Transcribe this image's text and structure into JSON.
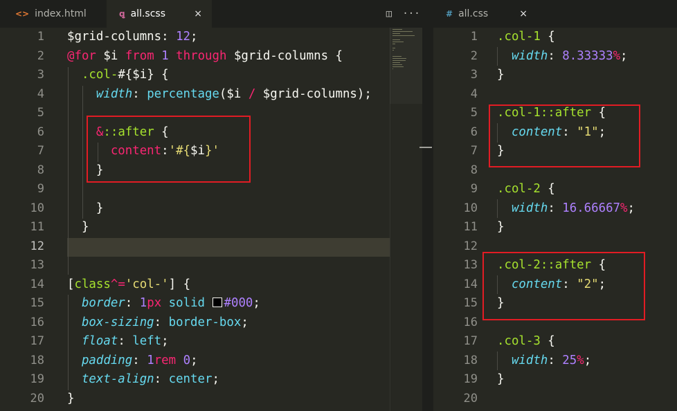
{
  "left_tabs": [
    {
      "label": "index.html",
      "icon": "code-icon",
      "glyph": "<>",
      "active": false
    },
    {
      "label": "all.scss",
      "icon": "scss-icon",
      "glyph": "ꝗ",
      "active": true,
      "close": "×"
    }
  ],
  "left_actions": [
    {
      "name": "split-editor-icon",
      "glyph": "◫"
    },
    {
      "name": "more-actions-icon",
      "glyph": "···"
    }
  ],
  "right_tabs": [
    {
      "label": "all.css",
      "icon": "hash-icon",
      "glyph": "#",
      "active": false,
      "close": "×"
    }
  ],
  "left_editor": {
    "line_numbers": [
      "1",
      "2",
      "3",
      "4",
      "5",
      "6",
      "7",
      "8",
      "9",
      "10",
      "11",
      "12",
      "13",
      "14",
      "15",
      "16",
      "17",
      "18",
      "19",
      "20"
    ],
    "current_line": "12",
    "lines": [
      [
        [
          "v",
          "$grid-columns"
        ],
        [
          "o",
          ": "
        ],
        [
          "n",
          "12"
        ],
        [
          "o",
          ";"
        ]
      ],
      [
        [
          "k",
          "@for"
        ],
        [
          "o",
          " "
        ],
        [
          "v",
          "$i"
        ],
        [
          "o",
          " "
        ],
        [
          "k",
          "from"
        ],
        [
          "o",
          " "
        ],
        [
          "n",
          "1"
        ],
        [
          "o",
          " "
        ],
        [
          "k",
          "through"
        ],
        [
          "o",
          " "
        ],
        [
          "v",
          "$grid-columns"
        ],
        [
          "o",
          " {"
        ]
      ],
      [
        [
          "o",
          "  "
        ],
        [
          "sel",
          ".col-"
        ],
        [
          "o",
          "#{"
        ],
        [
          "v",
          "$i"
        ],
        [
          "o",
          "} {"
        ]
      ],
      [
        [
          "o",
          "    "
        ],
        [
          "p",
          "width"
        ],
        [
          "o",
          ": "
        ],
        [
          "f",
          "percentage"
        ],
        [
          "o",
          "("
        ],
        [
          "v",
          "$i"
        ],
        [
          "o",
          " "
        ],
        [
          "k",
          "/"
        ],
        [
          "o",
          " "
        ],
        [
          "v",
          "$grid-columns"
        ],
        [
          "o",
          ");"
        ]
      ],
      [],
      [
        [
          "o",
          "    "
        ],
        [
          "k",
          "&"
        ],
        [
          "sel",
          "::after"
        ],
        [
          "o",
          " {"
        ]
      ],
      [
        [
          "o",
          "      "
        ],
        [
          "k",
          "content"
        ],
        [
          "o",
          ":"
        ],
        [
          "s",
          "'#{"
        ],
        [
          "v",
          "$i"
        ],
        [
          "s",
          "}'"
        ]
      ],
      [
        [
          "o",
          "    }"
        ]
      ],
      [],
      [
        [
          "o",
          "    }"
        ]
      ],
      [
        [
          "o",
          "  }"
        ]
      ],
      [],
      [],
      [
        [
          "o",
          "["
        ],
        [
          "sel",
          "class"
        ],
        [
          "k",
          "^="
        ],
        [
          "s",
          "'col-'"
        ],
        [
          "o",
          "] {"
        ]
      ],
      [
        [
          "o",
          "  "
        ],
        [
          "p",
          "border"
        ],
        [
          "o",
          ": "
        ],
        [
          "n",
          "1"
        ],
        [
          "k",
          "px"
        ],
        [
          "o",
          " "
        ],
        [
          "f",
          "solid"
        ],
        [
          "o",
          " "
        ],
        [
          "swatch",
          ""
        ],
        [
          "n",
          "#000"
        ],
        [
          "o",
          ";"
        ]
      ],
      [
        [
          "o",
          "  "
        ],
        [
          "p",
          "box-sizing"
        ],
        [
          "o",
          ": "
        ],
        [
          "f",
          "border-box"
        ],
        [
          "o",
          ";"
        ]
      ],
      [
        [
          "o",
          "  "
        ],
        [
          "p",
          "float"
        ],
        [
          "o",
          ": "
        ],
        [
          "f",
          "left"
        ],
        [
          "o",
          ";"
        ]
      ],
      [
        [
          "o",
          "  "
        ],
        [
          "p",
          "padding"
        ],
        [
          "o",
          ": "
        ],
        [
          "n",
          "1"
        ],
        [
          "k",
          "rem"
        ],
        [
          "o",
          " "
        ],
        [
          "n",
          "0"
        ],
        [
          "o",
          ";"
        ]
      ],
      [
        [
          "o",
          "  "
        ],
        [
          "p",
          "text-align"
        ],
        [
          "o",
          ": "
        ],
        [
          "f",
          "center"
        ],
        [
          "o",
          ";"
        ]
      ],
      [
        [
          "o",
          "}"
        ]
      ]
    ]
  },
  "right_editor": {
    "line_numbers": [
      "1",
      "2",
      "3",
      "4",
      "5",
      "6",
      "7",
      "8",
      "9",
      "10",
      "11",
      "12",
      "13",
      "14",
      "15",
      "16",
      "17",
      "18",
      "19",
      "20"
    ],
    "lines": [
      [
        [
          "sel",
          ".col-1"
        ],
        [
          "o",
          " {"
        ]
      ],
      [
        [
          "o",
          "  "
        ],
        [
          "p",
          "width"
        ],
        [
          "o",
          ": "
        ],
        [
          "n",
          "8.33333"
        ],
        [
          "k",
          "%"
        ],
        [
          "o",
          ";"
        ]
      ],
      [
        [
          "o",
          "}"
        ]
      ],
      [],
      [
        [
          "sel",
          ".col-1::after"
        ],
        [
          "o",
          " {"
        ]
      ],
      [
        [
          "o",
          "  "
        ],
        [
          "p",
          "content"
        ],
        [
          "o",
          ": "
        ],
        [
          "s",
          "\"1\""
        ],
        [
          "o",
          ";"
        ]
      ],
      [
        [
          "o",
          "}"
        ]
      ],
      [],
      [
        [
          "sel",
          ".col-2"
        ],
        [
          "o",
          " {"
        ]
      ],
      [
        [
          "o",
          "  "
        ],
        [
          "p",
          "width"
        ],
        [
          "o",
          ": "
        ],
        [
          "n",
          "16.66667"
        ],
        [
          "k",
          "%"
        ],
        [
          "o",
          ";"
        ]
      ],
      [
        [
          "o",
          "}"
        ]
      ],
      [],
      [
        [
          "sel",
          ".col-2::after"
        ],
        [
          "o",
          " {"
        ]
      ],
      [
        [
          "o",
          "  "
        ],
        [
          "p",
          "content"
        ],
        [
          "o",
          ": "
        ],
        [
          "s",
          "\"2\""
        ],
        [
          "o",
          ";"
        ]
      ],
      [
        [
          "o",
          "}"
        ]
      ],
      [],
      [
        [
          "sel",
          ".col-3"
        ],
        [
          "o",
          " {"
        ]
      ],
      [
        [
          "o",
          "  "
        ],
        [
          "p",
          "width"
        ],
        [
          "o",
          ": "
        ],
        [
          "n",
          "25"
        ],
        [
          "k",
          "%"
        ],
        [
          "o",
          ";"
        ]
      ],
      [
        [
          "o",
          "}"
        ]
      ],
      []
    ]
  },
  "colors": {
    "background": "#272822",
    "highlight_box": "#e21c24",
    "keyword": "#f92672",
    "number": "#ae81ff",
    "string": "#e6db74",
    "selector": "#a6e22e",
    "property": "#66d9ef"
  }
}
